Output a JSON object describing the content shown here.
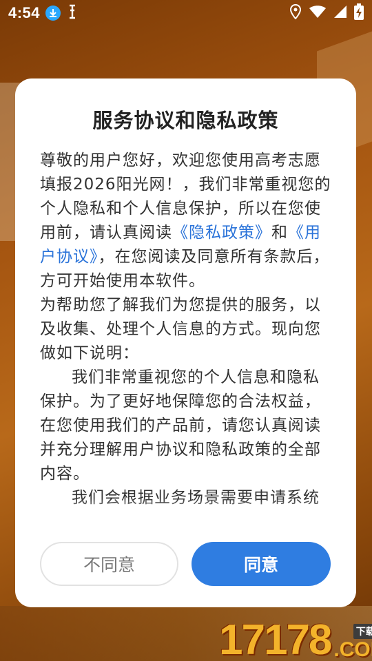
{
  "status_bar": {
    "time": "4:54",
    "icons": [
      "download-icon",
      "usb-debug-icon",
      "location-icon",
      "wifi-icon",
      "signal-icon",
      "battery-charging-icon"
    ]
  },
  "dialog": {
    "title": "服务协议和隐私政策",
    "content": {
      "p1_a": "尊敬的用户您好，欢迎您使用高考志愿填报2026阳光网！，我们非常重视您的个人隐私和个人信息保护，所以在您使用前，请认真阅读",
      "privacy_link": "《隐私政策》",
      "and": "和",
      "agreement_link": "《用户协议》",
      "p1_b": "，在您阅读及同意所有条款后，方可开始使用本软件。",
      "p2": "为帮助您了解我们为您提供的服务，以及收集、处理个人信息的方式。现向您做如下说明：",
      "p3": "我们非常重视您的个人信息和隐私保护。为了更好地保障您的合法权益，在您使用我们的产品前，请您认真阅读并充分理解用户协议和隐私政策的全部内容。",
      "p4": "我们会根据业务场景需要申请系统"
    },
    "disagree_label": "不同意",
    "agree_label": "同意"
  },
  "watermark": {
    "number": "17178",
    "tag": "下载站",
    "suffix": ".COM"
  },
  "colors": {
    "link": "#2a73d9",
    "primary_button": "#2f7de1",
    "watermark": "#f3b32b"
  }
}
